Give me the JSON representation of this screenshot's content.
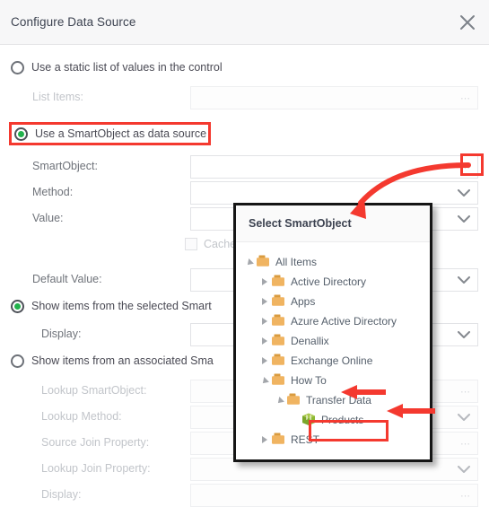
{
  "dialog": {
    "title": "Configure Data Source",
    "close_icon": "close-icon"
  },
  "options": {
    "static_list": {
      "label": "Use a static list of values in the control",
      "selected": false
    },
    "smartobject_source": {
      "label": "Use a SmartObject as data source",
      "selected": true,
      "highlighted": true
    },
    "show_selected": {
      "label": "Show items from the selected Smart",
      "selected": true
    },
    "show_associated": {
      "label": "Show items from an associated Sma",
      "selected": false
    }
  },
  "fields": {
    "list_items": {
      "label": "List Items:",
      "value": "",
      "disabled": true,
      "control": "ellipsis"
    },
    "smartobject": {
      "label": "SmartObject:",
      "value": "",
      "disabled": false,
      "control": "ellipsis",
      "highlighted": true
    },
    "method": {
      "label": "Method:",
      "value": "",
      "disabled": false,
      "control": "chevron"
    },
    "value": {
      "label": "Value:",
      "value": "",
      "disabled": false,
      "control": "chevron"
    },
    "cache": {
      "label": "Cache t",
      "checked": false
    },
    "default_value": {
      "label": "Default Value:",
      "value": "",
      "disabled": false,
      "control": "chevron"
    },
    "display_1": {
      "label": "Display:",
      "value": "",
      "disabled": false,
      "control": "chevron"
    },
    "lookup_smartobject": {
      "label": "Lookup SmartObject:",
      "value": "",
      "disabled": true,
      "control": "ellipsis"
    },
    "lookup_method": {
      "label": "Lookup Method:",
      "value": "",
      "disabled": true,
      "control": "chevron"
    },
    "source_join_property": {
      "label": "Source Join Property:",
      "value": "",
      "disabled": true,
      "control": "chevron"
    },
    "lookup_join_property": {
      "label": "Lookup Join Property:",
      "value": "",
      "disabled": true,
      "control": "chevron"
    },
    "display_2": {
      "label": "Display:",
      "value": "",
      "disabled": true,
      "control": "ellipsis"
    }
  },
  "popup": {
    "title": "Select SmartObject",
    "tree": [
      {
        "label": "All Items",
        "depth": 0,
        "state": "expanded",
        "icon": "folder-icon"
      },
      {
        "label": "Active Directory",
        "depth": 1,
        "state": "collapsed",
        "icon": "folder-icon"
      },
      {
        "label": "Apps",
        "depth": 1,
        "state": "collapsed",
        "icon": "folder-icon"
      },
      {
        "label": "Azure Active Directory",
        "depth": 1,
        "state": "collapsed",
        "icon": "folder-icon"
      },
      {
        "label": "Denallix",
        "depth": 1,
        "state": "collapsed",
        "icon": "folder-icon"
      },
      {
        "label": "Exchange Online",
        "depth": 1,
        "state": "collapsed",
        "icon": "folder-icon"
      },
      {
        "label": "How To",
        "depth": 1,
        "state": "expanded",
        "icon": "folder-icon",
        "annotated": true
      },
      {
        "label": "Transfer Data",
        "depth": 2,
        "state": "expanded",
        "icon": "folder-icon",
        "annotated": true
      },
      {
        "label": "Products",
        "depth": 3,
        "state": "leaf",
        "icon": "smartobject-cube-icon",
        "highlighted": true
      },
      {
        "label": "REST",
        "depth": 1,
        "state": "collapsed",
        "icon": "folder-icon"
      }
    ]
  },
  "colors": {
    "annotation_red": "#f4392f",
    "radio_green": "#22b24c",
    "folder_orange": "#f0b461",
    "folder_tab_orange": "#d99b3f",
    "cube_green": "#8cb833",
    "header_bg": "#f7f7f8",
    "title_text": "#3c4250",
    "label_text": "#6f737a",
    "disabled_text": "#c2c5ca"
  }
}
